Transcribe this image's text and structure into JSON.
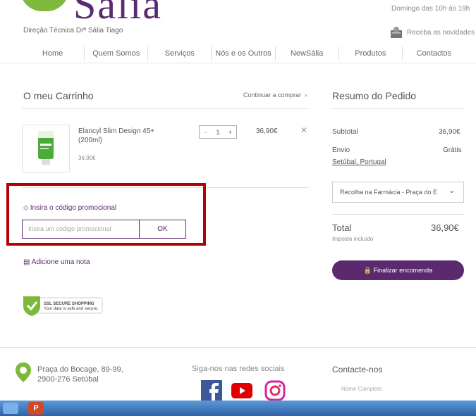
{
  "header": {
    "logo_text": "Sália",
    "subtitle": "Direção Técnica Drª Sália Tiago",
    "hours": "Domingo das 10h às 19h",
    "newsletter": "Receba as novidades"
  },
  "nav": [
    "Home",
    "Quem Somos",
    "Serviços",
    "Nós e os Outros",
    "NewSália",
    "Produtos",
    "Contactos"
  ],
  "cart": {
    "title": "O meu Carrinho",
    "continue_label": "Continuar a comprar",
    "item": {
      "name": "Elancyl Slim Design 45+ (200ml)",
      "unit_price": "36,90€",
      "quantity": "1",
      "line_total": "36,90€"
    },
    "promo": {
      "label": "Insira o código promocional",
      "placeholder": "Insira um código promocional",
      "ok_label": "OK"
    },
    "note_label": "Adicione uma nota",
    "ssl_title": "SSL SECURE SHOPPING",
    "ssl_sub": "Your data is safe and secure."
  },
  "summary": {
    "title": "Resumo do Pedido",
    "subtotal_label": "Subtotal",
    "subtotal_value": "36,90€",
    "shipping_label": "Envio",
    "shipping_value": "Grátis",
    "location": "Setúbal, Portugal",
    "shipping_option": "Recolha na Farmácia - Praça do E",
    "total_label": "Total",
    "total_value": "36,90€",
    "tax_note": "Imposto incluído",
    "checkout_label": "Finalizar encomenda"
  },
  "footer": {
    "address_line1": "Praça do Bocage, 89-99,",
    "address_line2": "2900-276 Setúbal",
    "social_title": "Siga-nos nas redes sociais",
    "contact_title": "Contacte-nos",
    "name_placeholder": "Nome Completo"
  },
  "colors": {
    "brand_purple": "#5b2a6e",
    "brand_green": "#7fb93c",
    "highlight_red": "#b40000"
  }
}
